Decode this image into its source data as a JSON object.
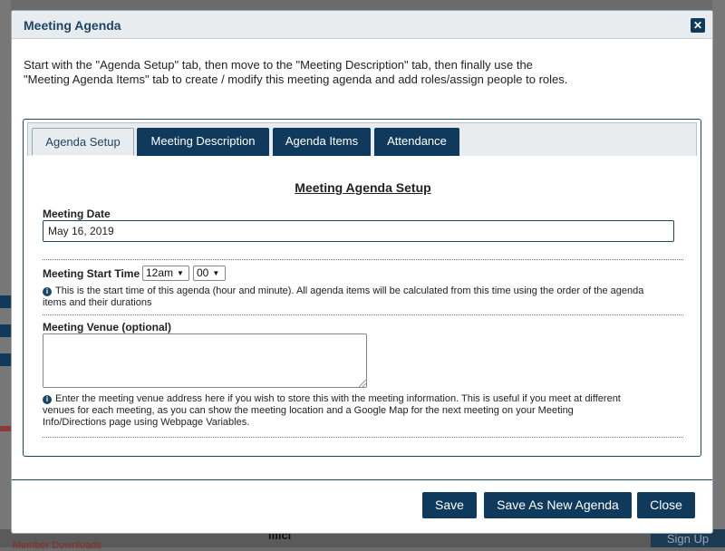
{
  "dialog": {
    "title": "Meeting Agenda",
    "close_icon": "close-icon",
    "intro_line1": "Start with the \"Agenda Setup\" tab, then move to the \"Meeting Description\" tab, then finally use the",
    "intro_line2": "\"Meeting Agenda Items\" tab to create / modify this meeting agenda and add roles/assign people to roles."
  },
  "tabs": [
    {
      "label": "Agenda Setup",
      "active": true
    },
    {
      "label": "Meeting Description",
      "active": false
    },
    {
      "label": "Agenda Items",
      "active": false
    },
    {
      "label": "Attendance",
      "active": false
    }
  ],
  "setup": {
    "heading": "Meeting Agenda Setup",
    "date_label": "Meeting Date",
    "date_value": "May 16, 2019",
    "start_time_label": "Meeting Start Time",
    "hour_value": "12am",
    "minute_value": "00",
    "start_time_hint_line1": "This is the start time of this agenda (hour and minute). All agenda items will be calculated from this time using the order of the agenda",
    "start_time_hint_line2": "items and their durations",
    "venue_label": "Meeting Venue (optional)",
    "venue_value": "",
    "venue_hint_line1": "Enter the meeting venue address here if you wish to store this with the meeting information. This is useful if you meet at different",
    "venue_hint_line2": "venues for each meeting, as you can show the meeting location and a Google Map for the next meeting on your Meeting",
    "venue_hint_line3": "Info/Directions page using Webpage Variables."
  },
  "buttons": {
    "save": "Save",
    "save_as_new": "Save As New Agenda",
    "close": "Close"
  },
  "background": {
    "sign_up": "Sign Up",
    "partial_word": "illici",
    "downloads": "Member Downloads"
  },
  "colors": {
    "primary": "#0f3a5c",
    "title_text": "#1d4566",
    "titlebar_bg": "#e8ecef"
  }
}
